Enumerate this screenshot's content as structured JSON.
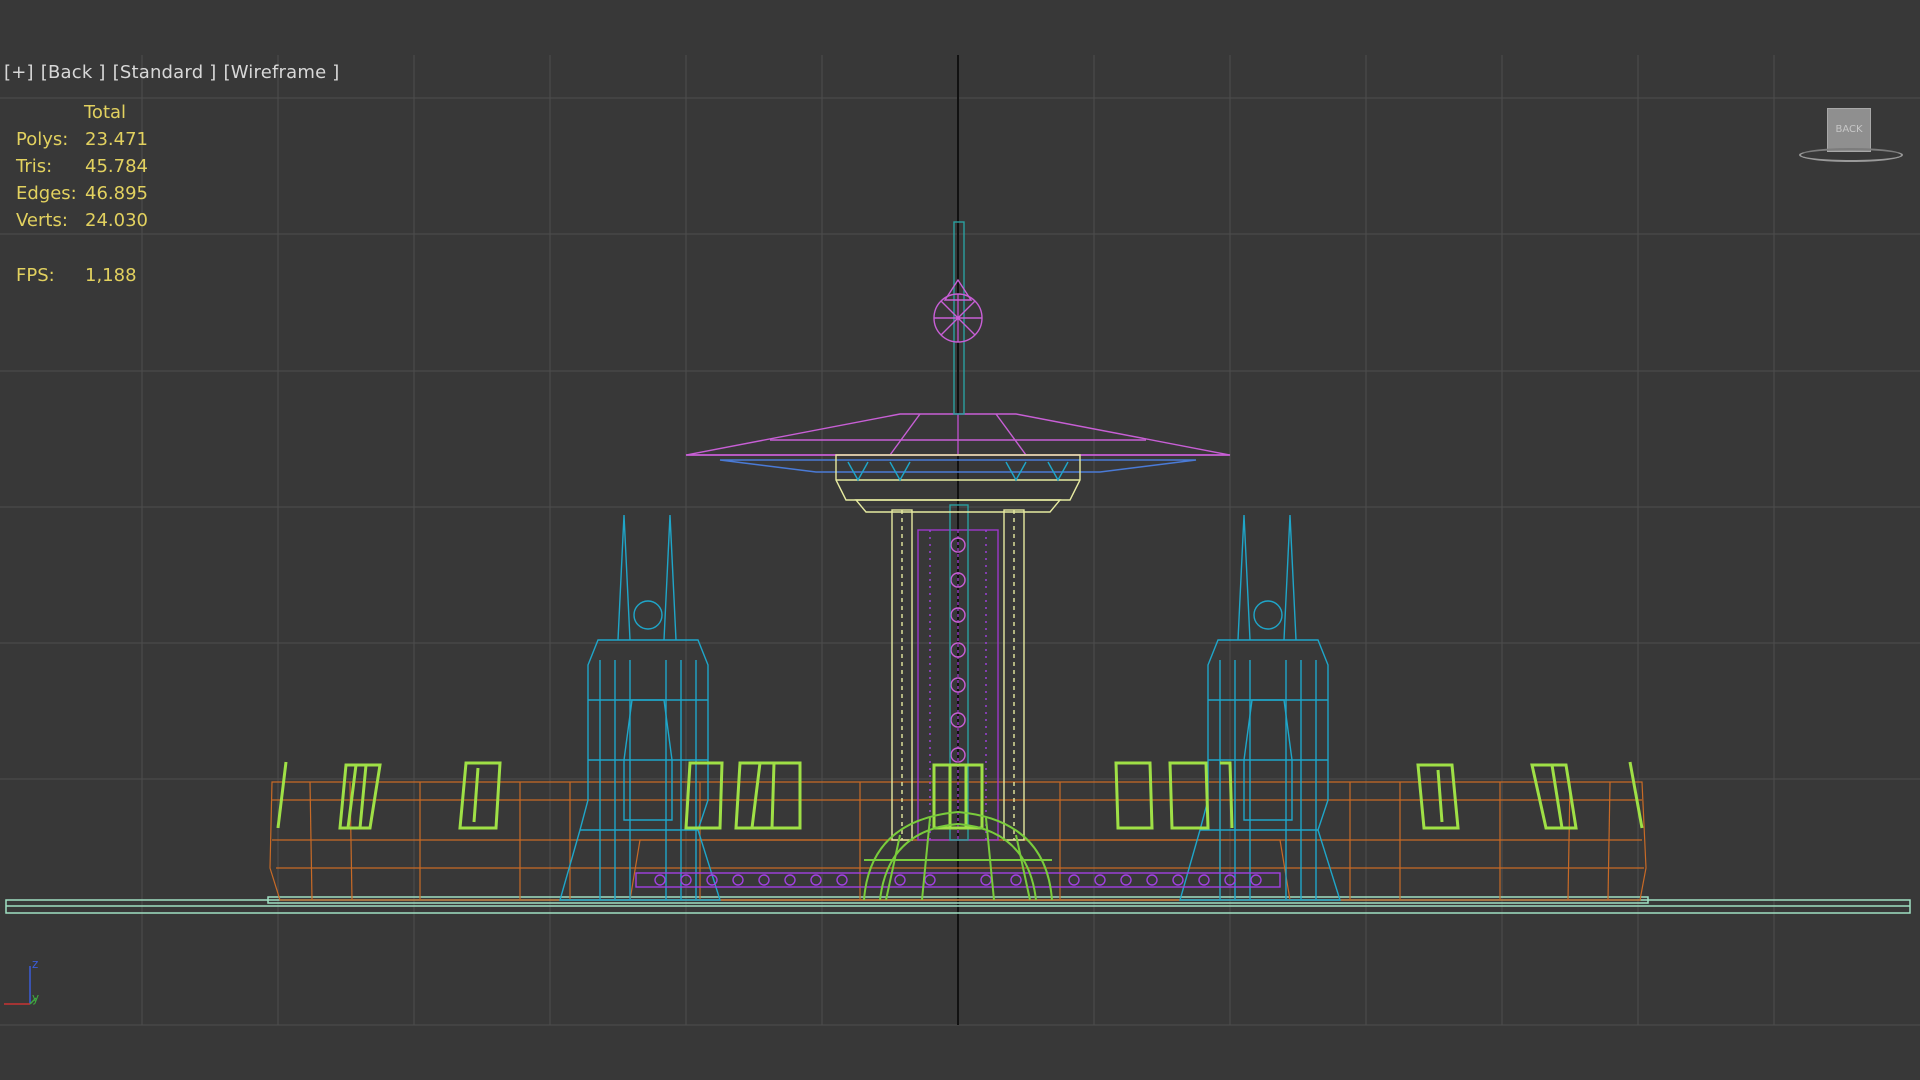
{
  "viewport": {
    "label_parts": [
      "[+]",
      "[Back ]",
      "[Standard ]",
      "[Wireframe ]"
    ],
    "stats": {
      "header": "Total",
      "rows": [
        {
          "label": "Polys:",
          "value": "23.471"
        },
        {
          "label": "Tris:",
          "value": "45.784"
        },
        {
          "label": "Edges:",
          "value": "46.895"
        },
        {
          "label": "Verts:",
          "value": "24.030"
        }
      ],
      "fps_label": "FPS:",
      "fps_value": "1,188"
    },
    "viewcube_label": "BACK",
    "axis": {
      "z": "z",
      "y": "y"
    }
  },
  "colors": {
    "background": "#383838",
    "grid": "#505050",
    "axis_line": "#111111",
    "stats_text": "#e2d15f",
    "wire_cyan": "#1fa6c9",
    "wire_magenta": "#c85fd6",
    "wire_green": "#9fe046",
    "wire_yellow": "#e6eaa0",
    "wire_orange": "#c86a26",
    "wire_mint": "#9fe0c2",
    "wire_purple": "#a140e0"
  }
}
